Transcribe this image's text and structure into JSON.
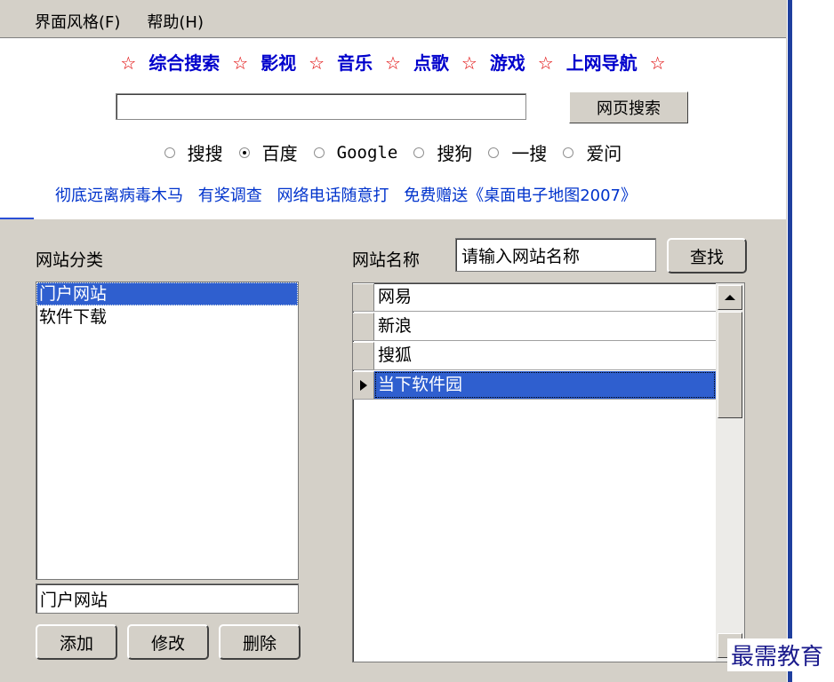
{
  "menu": {
    "items": [
      "界面风格(F)",
      "帮助(H)"
    ]
  },
  "web": {
    "nav_links": [
      "综合搜索",
      "影视",
      "音乐",
      "点歌",
      "游戏",
      "上网导航"
    ],
    "star": "☆",
    "search_value": "",
    "search_button": "网页搜索",
    "engines": [
      {
        "label": "搜搜",
        "checked": false
      },
      {
        "label": "百度",
        "checked": true
      },
      {
        "label": "Google",
        "checked": false
      },
      {
        "label": "搜狗",
        "checked": false
      },
      {
        "label": "一搜",
        "checked": false
      },
      {
        "label": "爱问",
        "checked": false
      }
    ],
    "promo_links": [
      "彻底远离病毒木马",
      "有奖调查",
      "网络电话随意打",
      "免费赠送《桌面电子地图2007》"
    ]
  },
  "category": {
    "label": "网站分类",
    "items": [
      {
        "text": "门户网站",
        "selected": true
      },
      {
        "text": "软件下载",
        "selected": false
      }
    ],
    "edit_value": "门户网站",
    "buttons": {
      "add": "添加",
      "modify": "修改",
      "delete": "删除"
    }
  },
  "site": {
    "label": "网站名称",
    "input_value": "请输入网站名称",
    "find_button": "查找",
    "rows": [
      {
        "name": "网易",
        "selected": false
      },
      {
        "name": "新浪",
        "selected": false
      },
      {
        "name": "搜狐",
        "selected": false
      },
      {
        "name": "当下软件园",
        "selected": true
      }
    ]
  },
  "watermark": "最需教育",
  "colors": {
    "selection": "#2f5fcf",
    "link": "#0033cc",
    "star": "#e00000",
    "face": "#d4d0c8"
  }
}
